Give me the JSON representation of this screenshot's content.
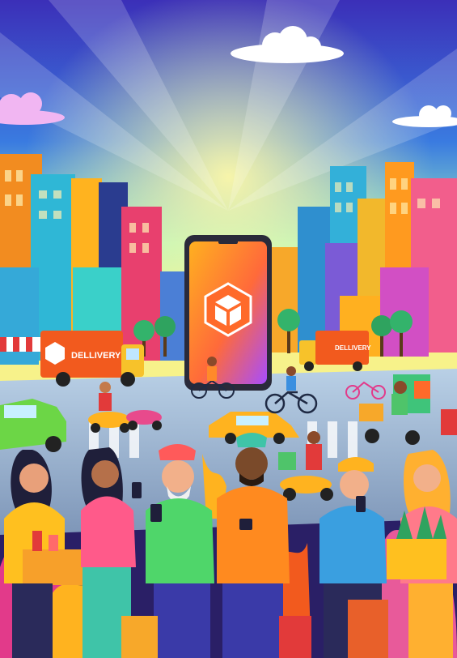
{
  "illustration": {
    "subject": "city delivery app scene",
    "truck_left_label": "DELLIVERY",
    "truck_right_label": "DELLIVERY",
    "colors": {
      "sky_top": "#3b3fd6",
      "sky_glow": "#9ff2c0",
      "phone_gradient_top": "#ffb020",
      "phone_gradient_bottom": "#a64dff",
      "truck": "#f25a1e",
      "road": "#9fb7cf",
      "foliage": "#e23a8a"
    },
    "icons": [
      "box-logo-icon",
      "cloud-icon",
      "bicycle-icon",
      "scooter-icon",
      "car-icon",
      "smartphone-icon"
    ]
  }
}
